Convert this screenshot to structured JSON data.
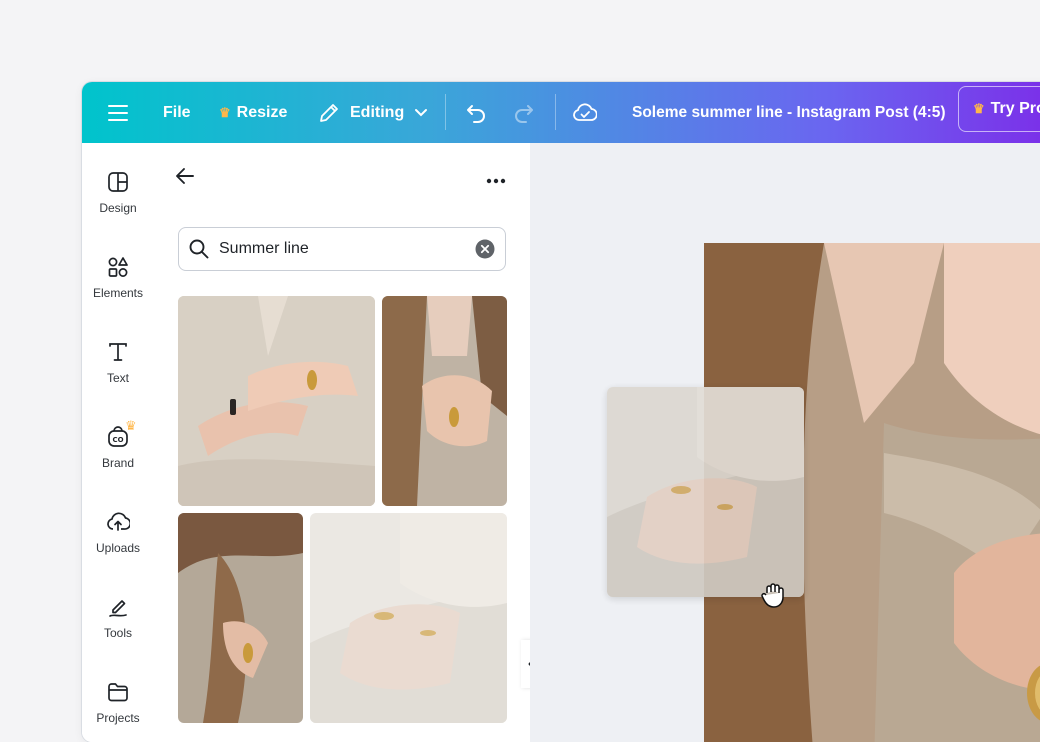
{
  "topbar": {
    "menu_icon": "hamburger-icon",
    "file_label": "File",
    "resize_label": "Resize",
    "editing_label": "Editing",
    "document_title": "Soleme summer line - Instagram Post (4:5)",
    "try_pro_label": "Try Pro"
  },
  "sidebar": {
    "items": [
      {
        "label": "Design",
        "icon": "layout-icon"
      },
      {
        "label": "Elements",
        "icon": "shapes-icon"
      },
      {
        "label": "Text",
        "icon": "text-icon"
      },
      {
        "label": "Brand",
        "icon": "brand-icon",
        "premium": true
      },
      {
        "label": "Uploads",
        "icon": "upload-cloud-icon"
      },
      {
        "label": "Tools",
        "icon": "pen-tool-icon"
      },
      {
        "label": "Projects",
        "icon": "folder-icon"
      }
    ]
  },
  "panel": {
    "search_value": "Summer line",
    "results": [
      "photo-hands-rings-shirt",
      "photo-hair-ring",
      "photo-hair-ring-2",
      "photo-hand-rings-pale"
    ]
  },
  "colors": {
    "topbar_start": "#00c4cc",
    "topbar_end": "#7d2ae8",
    "premium_crown": "#ffb74a"
  }
}
